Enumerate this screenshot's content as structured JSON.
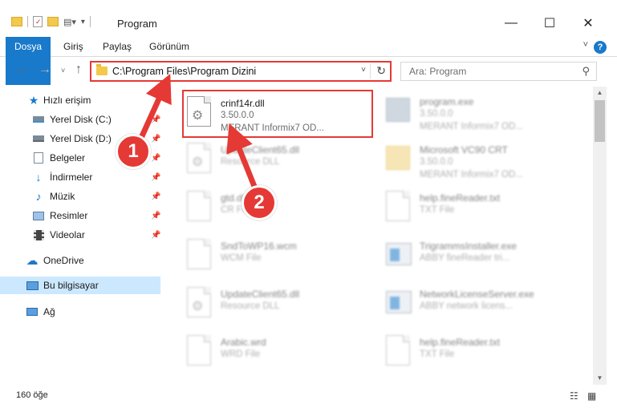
{
  "window": {
    "title": "Program",
    "minimize": "—",
    "maximize": "☐",
    "close": "✕"
  },
  "ribbon": {
    "tabs": [
      "Dosya",
      "Giriş",
      "Paylaş",
      "Görünüm"
    ],
    "accent": "#1979ca"
  },
  "address": {
    "path": "C:\\Program Files\\Program Dizini",
    "search_placeholder": "Ara: Program"
  },
  "sidebar": {
    "quick_access": "Hızlı erişim",
    "items": [
      {
        "label": "Yerel Disk (C:)",
        "icon": "drive-icon",
        "pinned": true
      },
      {
        "label": "Yerel Disk (D:)",
        "icon": "drive-icon",
        "pinned": true
      },
      {
        "label": "Belgeler",
        "icon": "documents-icon",
        "pinned": true
      },
      {
        "label": "İndirmeler",
        "icon": "downloads-icon",
        "pinned": true
      },
      {
        "label": "Müzik",
        "icon": "music-icon",
        "pinned": true
      },
      {
        "label": "Resimler",
        "icon": "pictures-icon",
        "pinned": true
      },
      {
        "label": "Videolar",
        "icon": "videos-icon",
        "pinned": true
      }
    ],
    "onedrive": "OneDrive",
    "this_pc": "Bu bilgisayar",
    "network": "Ağ"
  },
  "files": [
    {
      "name": "crinf14r.dll",
      "line2": "3.50.0.0",
      "line3": "MERANT Informix7 OD...",
      "highlighted": true
    },
    {
      "name": "program.exe",
      "line2": "3.50.0.0",
      "line3": "MERANT Informix7 OD..."
    },
    {
      "name": "UpdateClient65.dll",
      "line2": "Resource DLL",
      "line3": ""
    },
    {
      "name": "Microsoft VC90 CRT",
      "line2": "3.50.0.0",
      "line3": "MERANT Informix7 OD..."
    },
    {
      "name": "gtd.dll",
      "line2": "CR File",
      "line3": ""
    },
    {
      "name": "help.fineReader.txt",
      "line2": "TXT File",
      "line3": ""
    },
    {
      "name": "SndToWP16.wcm",
      "line2": "WCM File",
      "line3": ""
    },
    {
      "name": "TrigrammsInstaller.exe",
      "line2": "ABBY fineReader tri...",
      "line3": ""
    },
    {
      "name": "UpdateClient65.dll",
      "line2": "Resource DLL",
      "line3": ""
    },
    {
      "name": "NetworkLicenseServer.exe",
      "line2": "ABBY network licens...",
      "line3": ""
    },
    {
      "name": "Arabic.wrd",
      "line2": "WRD File",
      "line3": ""
    },
    {
      "name": "help.fineReader.txt",
      "line2": "TXT File",
      "line3": ""
    }
  ],
  "status": {
    "count": "160 öğe"
  },
  "callouts": [
    "1",
    "2"
  ],
  "colors": {
    "callout": "#e53935",
    "selection": "#cce8ff"
  }
}
